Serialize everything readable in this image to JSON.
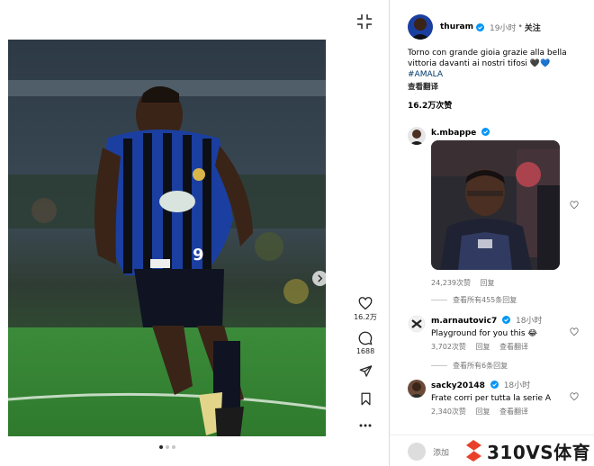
{
  "post": {
    "author": "thuram",
    "time": "19小时",
    "follow_label": "关注",
    "caption": "Torno con grande gioia grazie alla bella vittoria davanti ai nostri tifosi 🖤💙",
    "hashtag": "#AMALA",
    "see_translation": "查看翻译",
    "likes": "16.2万次赞",
    "carousel_position": 1,
    "carousel_total": 3
  },
  "actions": {
    "like_count": "16.2万",
    "comment_count": "1688"
  },
  "comments": [
    {
      "username": "k.mbappe",
      "verified": true,
      "time": "",
      "text": "",
      "likes": "24,239次赞",
      "reply_label": "回复",
      "view_replies": "查看所有455条回复"
    },
    {
      "username": "m.arnautovic7",
      "verified": true,
      "time": "18小时",
      "text": "Playground for you this 😂",
      "likes": "3,702次赞",
      "reply_label": "回复",
      "translate_label": "查看翻译",
      "view_replies": "查看所有6条回复"
    },
    {
      "username": "sacky20148",
      "verified": true,
      "time": "18小时",
      "text": "Frate corri per tutta la serie A",
      "likes": "2,340次赞",
      "reply_label": "回复",
      "translate_label": "查看翻译"
    }
  ],
  "composer": {
    "placeholder": "添加"
  },
  "watermark": {
    "text": "310VS体育",
    "color": "#e8402a"
  },
  "colors": {
    "inter_blue": "#1b3fa0",
    "pitch_green": "#3d8a3a",
    "verified_blue": "#0095f6"
  }
}
